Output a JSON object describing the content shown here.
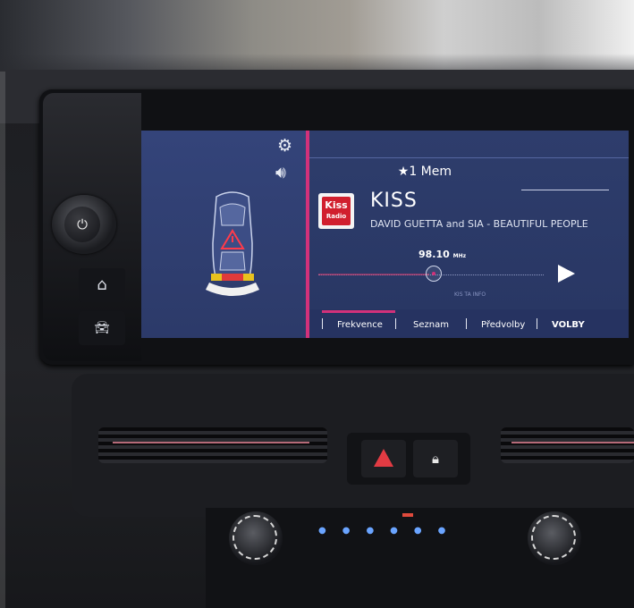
{
  "screen": {
    "left_icons": [
      "gear-icon",
      "speaker-icon"
    ],
    "parking": {
      "sensor_colors": [
        "#e8c21e",
        "#e03a3a",
        "#e8c21e",
        "#f0f0f0"
      ],
      "warning_icon": "warning-triangle-icon"
    },
    "memory": {
      "star": "★",
      "label": "1 Mem"
    },
    "station": {
      "logo_top": "Kiss",
      "logo_bottom": "Radio",
      "name": "KISS",
      "radiotext": "DAVID GUETTA and SIA - BEAUTIFUL PEOPLE",
      "frequency": "98.10",
      "frequency_unit": "MHz",
      "rds_flags": "KIS   TA   INFO"
    },
    "tabs": [
      {
        "label": "Frekvence",
        "active": true
      },
      {
        "label": "Seznam",
        "active": false
      },
      {
        "label": "Předvolby",
        "active": false
      },
      {
        "label": "VOLBY",
        "active": false
      }
    ],
    "accent_color": "#d2317a"
  },
  "hardware": {
    "power_knob_icon": "power-icon",
    "home_button_icon": "home-icon",
    "car_button_icon": "car-icon",
    "hazard_icon": "hazard-icon",
    "lock_icon": "lock-icon"
  }
}
